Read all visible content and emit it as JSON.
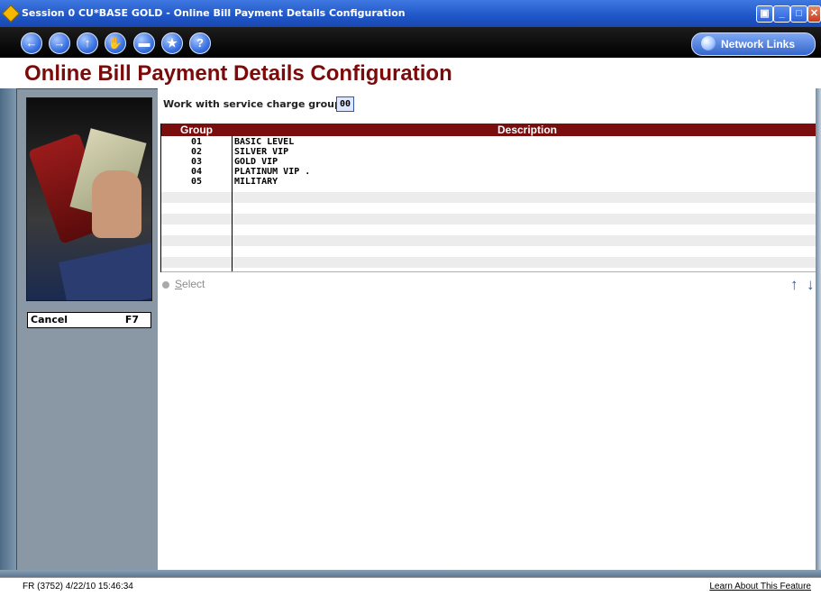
{
  "window": {
    "title": "Session 0 CU*BASE GOLD - Online Bill Payment Details Configuration",
    "buttons": [
      "restore",
      "minimize",
      "maximize",
      "close"
    ]
  },
  "toolbar": {
    "nav_icons": [
      "back-icon",
      "forward-icon",
      "up-icon",
      "stop-icon",
      "print-icon",
      "favorite-icon",
      "help-icon"
    ],
    "network_links_label": "Network Links"
  },
  "page_title": "Online Bill Payment Details Configuration",
  "sidebar": {
    "cancel_label": "Cancel",
    "cancel_key": "F7"
  },
  "filter": {
    "label": "Work with service charge group",
    "value": "00"
  },
  "table": {
    "columns": [
      "Group",
      "Description"
    ],
    "rows": [
      {
        "group": "01",
        "description": "BASIC LEVEL"
      },
      {
        "group": "02",
        "description": "SILVER VIP"
      },
      {
        "group": "03",
        "description": "GOLD VIP"
      },
      {
        "group": "04",
        "description": "PLATINUM VIP ."
      },
      {
        "group": "05",
        "description": "MILITARY"
      }
    ]
  },
  "actions": {
    "select_label": "Select",
    "select_underline": "S",
    "select_rest": "elect"
  },
  "status": {
    "left": "FR (3752) 4/22/10 15:46:34",
    "right": "Learn About This Feature"
  },
  "colors": {
    "title_red": "#7b0a0a",
    "header_red": "#7a0d0d",
    "stripe_gray": "#ececec",
    "accent_blue": "#1f55c8"
  }
}
